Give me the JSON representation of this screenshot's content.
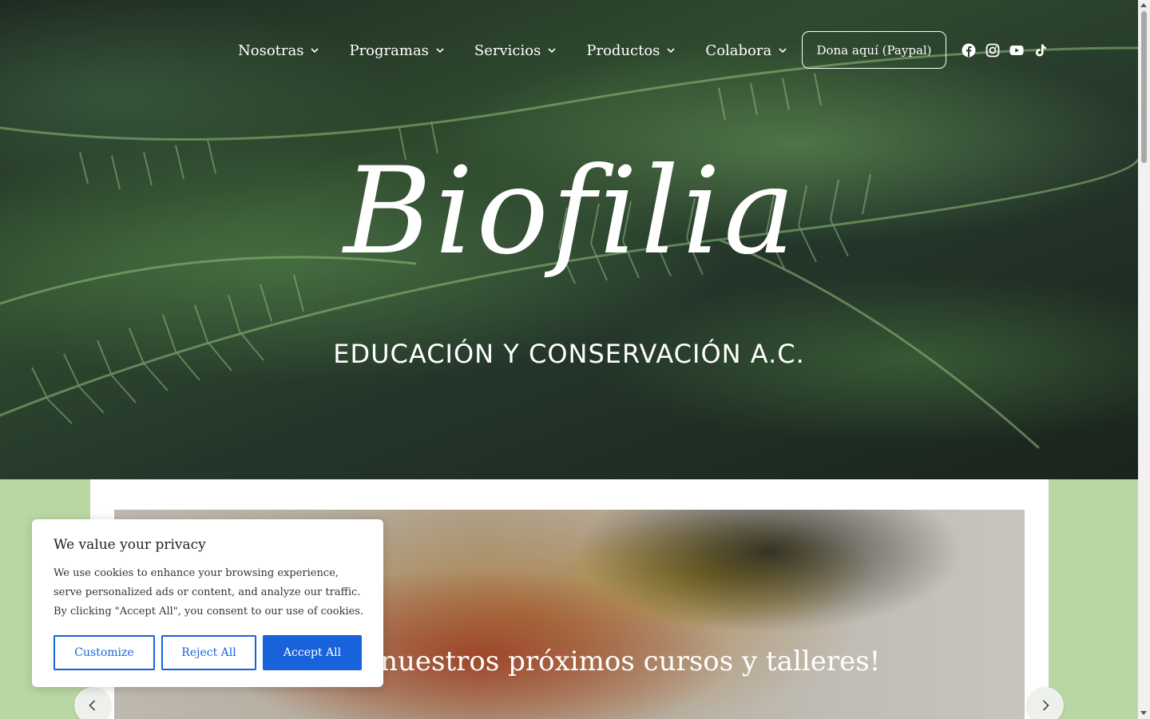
{
  "nav": {
    "items": [
      {
        "label": "Nosotras",
        "icon": "chevron-down-icon"
      },
      {
        "label": "Programas",
        "icon": "chevron-down-icon"
      },
      {
        "label": "Servicios",
        "icon": "chevron-down-icon"
      },
      {
        "label": "Productos",
        "icon": "chevron-down-icon"
      },
      {
        "label": "Colabora",
        "icon": "chevron-down-icon"
      }
    ],
    "donate_label": "Dona aquí (Paypal)",
    "socials": [
      "facebook-icon",
      "instagram-icon",
      "youtube-icon",
      "tiktok-icon"
    ]
  },
  "hero": {
    "logo_text": "Biofilia",
    "tagline": "EDUCACIÓN Y CONSERVACIÓN A.C."
  },
  "slider": {
    "title": "¡Conoce nuestros próximos cursos y talleres!",
    "prev_icon": "chevron-left-icon",
    "next_icon": "chevron-right-icon"
  },
  "cookie": {
    "title": "We value your privacy",
    "text": "We use cookies to enhance your browsing experience, serve personalized ads or content, and analyze our traffic. By clicking \"Accept All\", you consent to our use of cookies.",
    "customize_label": "Customize",
    "reject_label": "Reject All",
    "accept_label": "Accept All"
  },
  "colors": {
    "accent": "#1863dc",
    "page_bg": "#b9d7a3",
    "hero_dark": "#1e2b22"
  }
}
